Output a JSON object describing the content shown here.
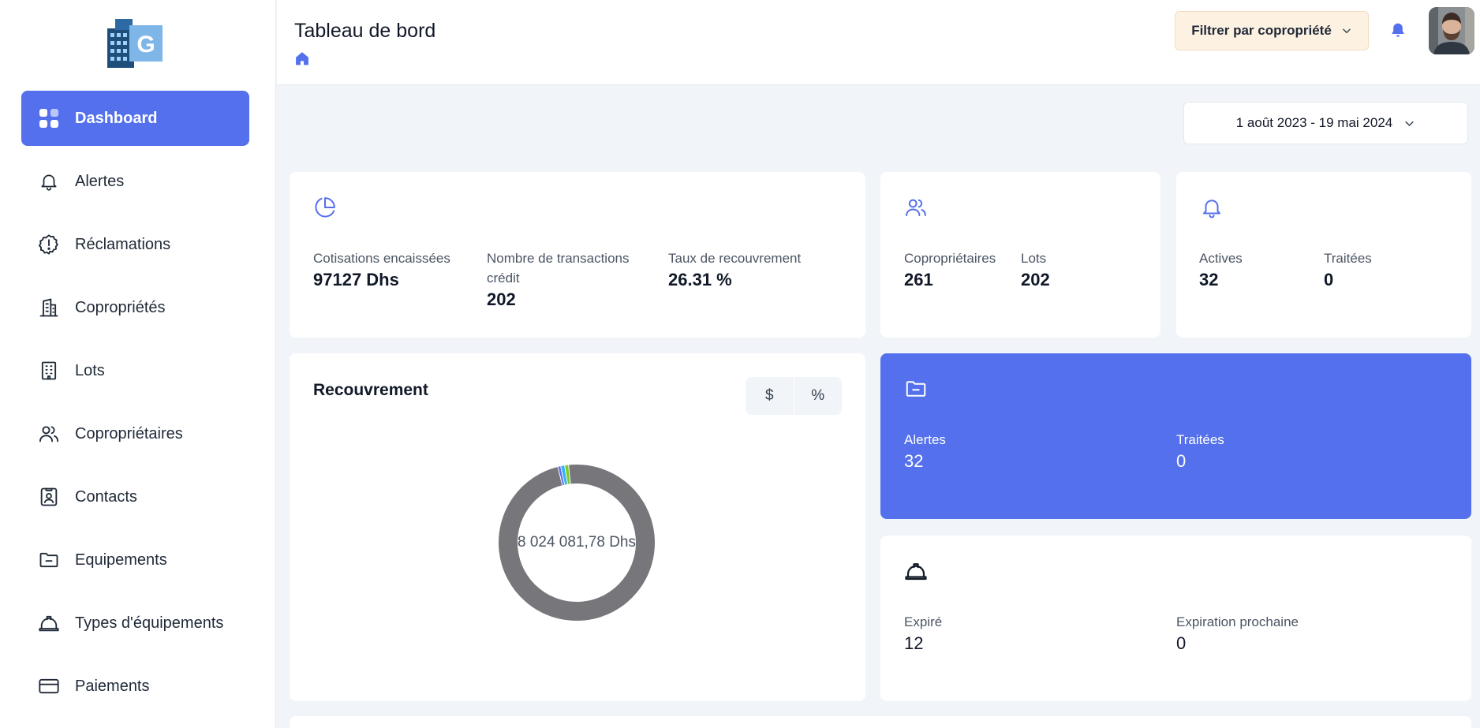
{
  "app": {
    "logo_letter": "G"
  },
  "sidebar": {
    "items": [
      {
        "label": "Dashboard",
        "icon": "dashboard-grid-icon",
        "active": true
      },
      {
        "label": "Alertes",
        "icon": "bell-icon"
      },
      {
        "label": "Réclamations",
        "icon": "alert-badge-icon"
      },
      {
        "label": "Copropriétés",
        "icon": "building-icon"
      },
      {
        "label": "Lots",
        "icon": "office-building-icon"
      },
      {
        "label": "Copropriétaires",
        "icon": "users-icon"
      },
      {
        "label": "Contacts",
        "icon": "contact-card-icon"
      },
      {
        "label": "Equipements",
        "icon": "folder-minus-icon"
      },
      {
        "label": "Types d'équipements",
        "icon": "hard-hat-icon"
      },
      {
        "label": "Paiements",
        "icon": "credit-card-icon"
      }
    ]
  },
  "header": {
    "title": "Tableau de bord",
    "filter_label": "Filtrer par copropriété"
  },
  "date_range": "1 août 2023 - 19 mai 2024",
  "cards": {
    "finance": {
      "icon": "pie-chart-icon",
      "stats": [
        {
          "label": "Cotisations encaissées",
          "value": "97127 Dhs"
        },
        {
          "label": "Nombre de transactions crédit",
          "value": "202"
        },
        {
          "label": "Taux de recouvrement",
          "value": "26.31 %"
        }
      ]
    },
    "owners": {
      "icon": "users-icon",
      "stats": [
        {
          "label": "Copropriétaires",
          "value": "261"
        },
        {
          "label": "Lots",
          "value": "202"
        }
      ]
    },
    "alerts_small": {
      "icon": "bell-icon",
      "stats": [
        {
          "label": "Actives",
          "value": "32"
        },
        {
          "label": "Traitées",
          "value": "0"
        }
      ]
    },
    "recouvrement": {
      "title": "Recouvrement",
      "toggle": [
        "$",
        "%"
      ],
      "center_label": "8 024 081,78 Dhs"
    },
    "claims": {
      "icon": "folder-minus-icon",
      "stats": [
        {
          "label": "Alertes",
          "value": "32"
        },
        {
          "label": "Traitées",
          "value": "0"
        }
      ]
    },
    "equipment": {
      "icon": "hard-hat-icon",
      "stats": [
        {
          "label": "Expiré",
          "value": "12"
        },
        {
          "label": "Expiration prochaine",
          "value": "0"
        }
      ]
    }
  },
  "chart_data": {
    "type": "pie",
    "values": [
      97,
      0.6,
      0.8,
      0.8
    ],
    "colors": [
      "#76767b",
      "#5b6ff0",
      "#36b3ee",
      "#7ecb2c"
    ]
  },
  "colors": {
    "accent": "#5470ec",
    "filter_bg": "#fdf1e2",
    "page_bg": "#f1f4f9"
  }
}
